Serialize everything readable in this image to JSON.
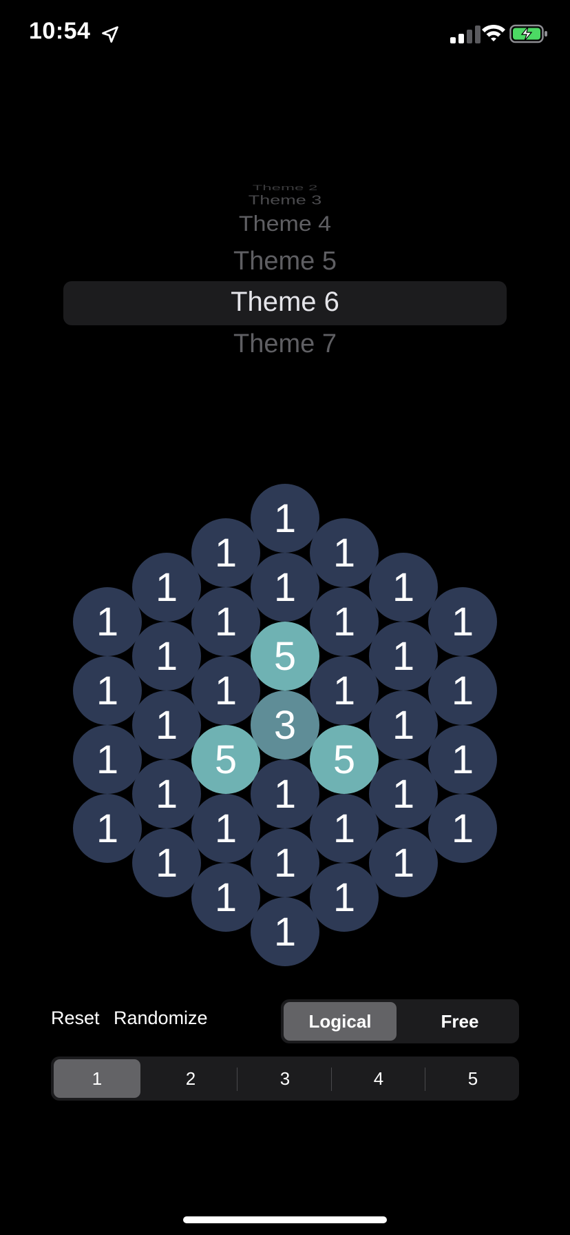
{
  "status_bar": {
    "time": "10:54",
    "icons": [
      "location-arrow-icon",
      "cellular-signal-icon",
      "wifi-icon",
      "battery-charging-icon"
    ],
    "battery_color": "#4cd964"
  },
  "theme_picker": {
    "items": [
      "Theme 2",
      "Theme 3",
      "Theme 4",
      "Theme 5",
      "Theme 6",
      "Theme 7"
    ],
    "selected": "Theme 6"
  },
  "board": {
    "colors": {
      "1": "#2e3a55",
      "3": "#5f8d97",
      "5": "#6fb2b3"
    },
    "cells": [
      {
        "q": 0,
        "r": -3,
        "value": "1"
      },
      {
        "q": -1,
        "r": -2,
        "value": "1"
      },
      {
        "q": 1,
        "r": -3,
        "value": "1"
      },
      {
        "q": -2,
        "r": -1,
        "value": "1"
      },
      {
        "q": 0,
        "r": -2,
        "value": "1"
      },
      {
        "q": 2,
        "r": -3,
        "value": "1"
      },
      {
        "q": -3,
        "r": 0,
        "value": "1"
      },
      {
        "q": -1,
        "r": -1,
        "value": "1"
      },
      {
        "q": 1,
        "r": -2,
        "value": "1"
      },
      {
        "q": 3,
        "r": -3,
        "value": "1"
      },
      {
        "q": -2,
        "r": 0,
        "value": "1"
      },
      {
        "q": 0,
        "r": -1,
        "value": "5"
      },
      {
        "q": 2,
        "r": -2,
        "value": "1"
      },
      {
        "q": -3,
        "r": 1,
        "value": "1"
      },
      {
        "q": -1,
        "r": 0,
        "value": "1"
      },
      {
        "q": 1,
        "r": -1,
        "value": "1"
      },
      {
        "q": 3,
        "r": -2,
        "value": "1"
      },
      {
        "q": -2,
        "r": 1,
        "value": "1"
      },
      {
        "q": 0,
        "r": 0,
        "value": "3"
      },
      {
        "q": 2,
        "r": -1,
        "value": "1"
      },
      {
        "q": -3,
        "r": 2,
        "value": "1"
      },
      {
        "q": -1,
        "r": 1,
        "value": "5"
      },
      {
        "q": 1,
        "r": 0,
        "value": "5"
      },
      {
        "q": 3,
        "r": -1,
        "value": "1"
      },
      {
        "q": -2,
        "r": 2,
        "value": "1"
      },
      {
        "q": 0,
        "r": 1,
        "value": "1"
      },
      {
        "q": 2,
        "r": 0,
        "value": "1"
      },
      {
        "q": -3,
        "r": 3,
        "value": "1"
      },
      {
        "q": -1,
        "r": 2,
        "value": "1"
      },
      {
        "q": 1,
        "r": 1,
        "value": "1"
      },
      {
        "q": 3,
        "r": 0,
        "value": "1"
      },
      {
        "q": -2,
        "r": 3,
        "value": "1"
      },
      {
        "q": 0,
        "r": 2,
        "value": "1"
      },
      {
        "q": 2,
        "r": 1,
        "value": "1"
      },
      {
        "q": -1,
        "r": 3,
        "value": "1"
      },
      {
        "q": 1,
        "r": 2,
        "value": "1"
      },
      {
        "q": 0,
        "r": 3,
        "value": "1"
      }
    ]
  },
  "controls": {
    "reset_label": "Reset",
    "randomize_label": "Randomize",
    "mode_options": [
      "Logical",
      "Free"
    ],
    "mode_selected": "Logical",
    "number_options": [
      "1",
      "2",
      "3",
      "4",
      "5"
    ],
    "number_selected": "1"
  }
}
